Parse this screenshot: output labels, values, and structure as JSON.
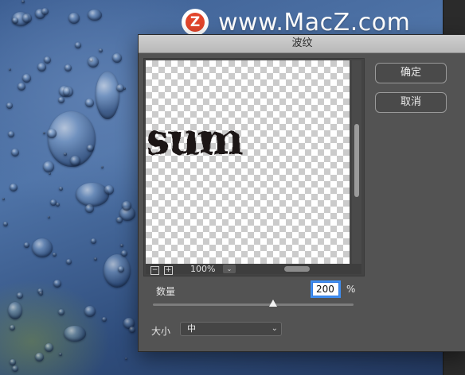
{
  "watermark": {
    "logo_letter": "Z",
    "text": "www.MacZ.com"
  },
  "dialog": {
    "title": "波纹",
    "ok_label": "确定",
    "cancel_label": "取消",
    "preview": {
      "text": "sum",
      "zoom_value": "100%",
      "zoom_out_symbol": "−",
      "zoom_in_symbol": "+",
      "dropdown_symbol": "⌄"
    },
    "amount": {
      "label": "数量",
      "value": "200",
      "unit": "%",
      "slider_fraction": 0.6
    },
    "size": {
      "label": "大小",
      "selected": "中",
      "chevron": "⌄"
    }
  },
  "colors": {
    "accent_focus": "#2f7be3",
    "dialog_bg": "#535353",
    "title_bar": "#c4c4c4"
  }
}
